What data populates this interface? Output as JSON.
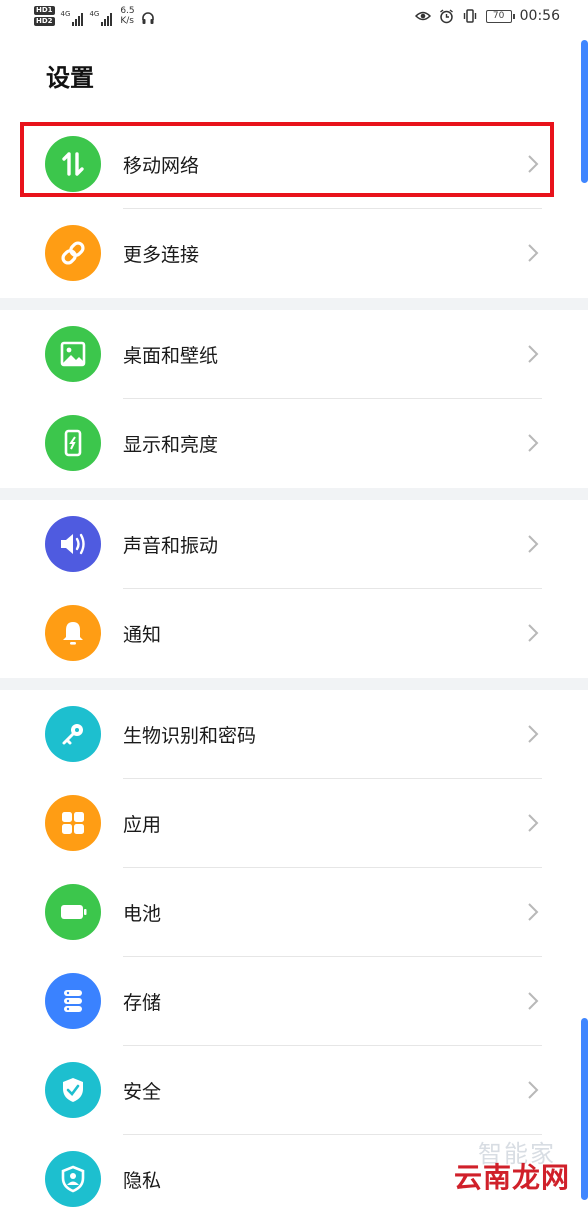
{
  "status_bar": {
    "hd1": "HD",
    "hd2": "HD",
    "sim1": "1",
    "sim2": "2",
    "net1": "4G",
    "net2": "4G",
    "speed_value": "6.5",
    "speed_unit": "K/s",
    "battery": "70",
    "time": "00:56"
  },
  "header": {
    "title": "设置"
  },
  "items": [
    {
      "label": "移动网络",
      "icon": "mobile-data-icon",
      "color": "#3cc64c"
    },
    {
      "label": "更多连接",
      "icon": "link-icon",
      "color": "#ff9d14"
    },
    {
      "label": "桌面和壁纸",
      "icon": "image-icon",
      "color": "#3cc64c"
    },
    {
      "label": "显示和亮度",
      "icon": "display-icon",
      "color": "#3cc64c"
    },
    {
      "label": "声音和振动",
      "icon": "speaker-icon",
      "color": "#4f5be0"
    },
    {
      "label": "通知",
      "icon": "bell-icon",
      "color": "#ff9d14"
    },
    {
      "label": "生物识别和密码",
      "icon": "key-icon",
      "color": "#1dbfcf"
    },
    {
      "label": "应用",
      "icon": "apps-icon",
      "color": "#ff9d14"
    },
    {
      "label": "电池",
      "icon": "battery-icon",
      "color": "#3cc64c"
    },
    {
      "label": "存储",
      "icon": "storage-icon",
      "color": "#3a82ff"
    },
    {
      "label": "安全",
      "icon": "shield-icon",
      "color": "#1dbfcf"
    },
    {
      "label": "隐私",
      "icon": "privacy-icon",
      "color": "#1dbfcf"
    }
  ],
  "watermark": {
    "top": "智能家",
    "bottom": "云南龙网"
  }
}
